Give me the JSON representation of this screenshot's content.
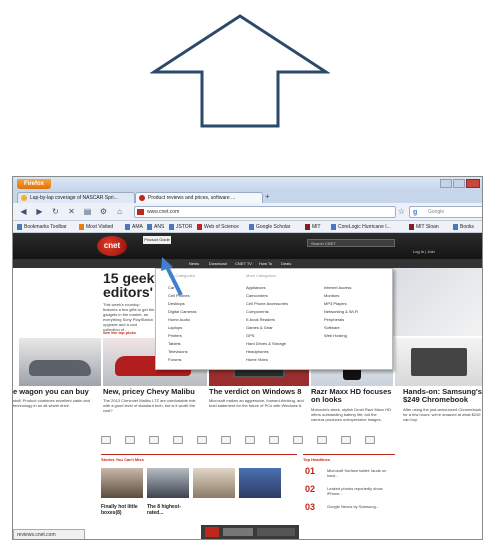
{
  "browser": {
    "app_button": "Firefox",
    "tabs": [
      {
        "label": "Lap-by-lap coverage of NASCAR Spri...",
        "icon": "nascar-icon"
      },
      {
        "label": "Product reviews and prices, software ...",
        "icon": "cnet-icon"
      }
    ],
    "url": "www.cnet.com",
    "search_placeholder": "Google",
    "bookmarks": [
      "Bookmarks Toolbar",
      "Most Visited",
      "AMA",
      "ANS",
      "JSTOR",
      "Web of Science",
      "Google Scholar",
      "MIT",
      "CoreLogic Hurricane I...",
      "MIT Sloan",
      "Books"
    ]
  },
  "cnet": {
    "logo": "cnet",
    "products_button": "Product Guide",
    "search_placeholder": "Search CNET",
    "header_link": "Log In | Join",
    "subnav": [
      "News",
      "Download",
      "CNET TV",
      "How To",
      "Deals"
    ],
    "headline_lines": [
      "15 geeky",
      "editors' c"
    ],
    "headline_body": "This week's roundup features a few gifts to get the gadgets in the market, an everything Sony PlayStation upgrade and a cool collection of ...",
    "see_picks": "See the top picks",
    "dropdown": {
      "head_left": "Top Categories",
      "head_right": "More Categories",
      "col1": [
        "Car",
        "Cell Phones",
        "Desktops",
        "Digital Cameras",
        "Home Audio",
        "Laptops",
        "Printers",
        "Tablets",
        "Televisions",
        "Forums"
      ],
      "col2": [
        "Appliances",
        "Camcorders",
        "Cell Phone Accessories",
        "Components",
        "E-book Readers",
        "Games & Gear",
        "GPS",
        "Hard Drives & Storage",
        "Headphones",
        "Home Video"
      ],
      "col3": [
        "Internet Access",
        "Monitors",
        "MP3 Players",
        "Networking & Wi-Fi",
        "Peripherals",
        "Software",
        "Web Hosting"
      ]
    },
    "stories": [
      {
        "title": "e wagon you can buy",
        "body": "stuff: Product combines excellent cabin and technology in an all-wheel drive"
      },
      {
        "title": "New, pricey Chevy Malibu",
        "body": "The 2013 Chevrolet Malibu LTZ are comfortable ride with a good level of standard tech, but is it worth the cost?"
      },
      {
        "title": "The verdict on Windows 8",
        "body": "Microsoft makes an aggressive, forward-thinking, and bold statement for the future of PCs with Windows 8."
      },
      {
        "title": "Razr Maxx HD focuses on looks",
        "body": "Motorola's sleek, stylish Droid Razr Maxx HD offers outstanding battery life, but the camera produces unimpressive images."
      },
      {
        "title": "Hands-on: Samsung's $249 Chromebook",
        "body": "After using the just-announced Chromebook for a few hours, we're amazed at what $249 can buy."
      }
    ],
    "stories_you_like": "Stories You Can't Miss",
    "top_headlines": "Top Headlines",
    "headlines": [
      {
        "num": "01",
        "text": "Microsoft Surface tablet: lauds on hard..."
      },
      {
        "num": "02",
        "text": "Leaked photos reportedly show iPhone..."
      },
      {
        "num": "03",
        "text": "Google Nexus by Samsung..."
      }
    ],
    "thumb_captions": [
      "Finally hot little boxes(8)",
      "The 8 highest-rated..."
    ]
  },
  "status_text": "reviews.cnet.com",
  "colors": {
    "cnet_red": "#c0261b",
    "firefox_orange": "#e8800f",
    "header_dark": "#1c1c1c"
  }
}
